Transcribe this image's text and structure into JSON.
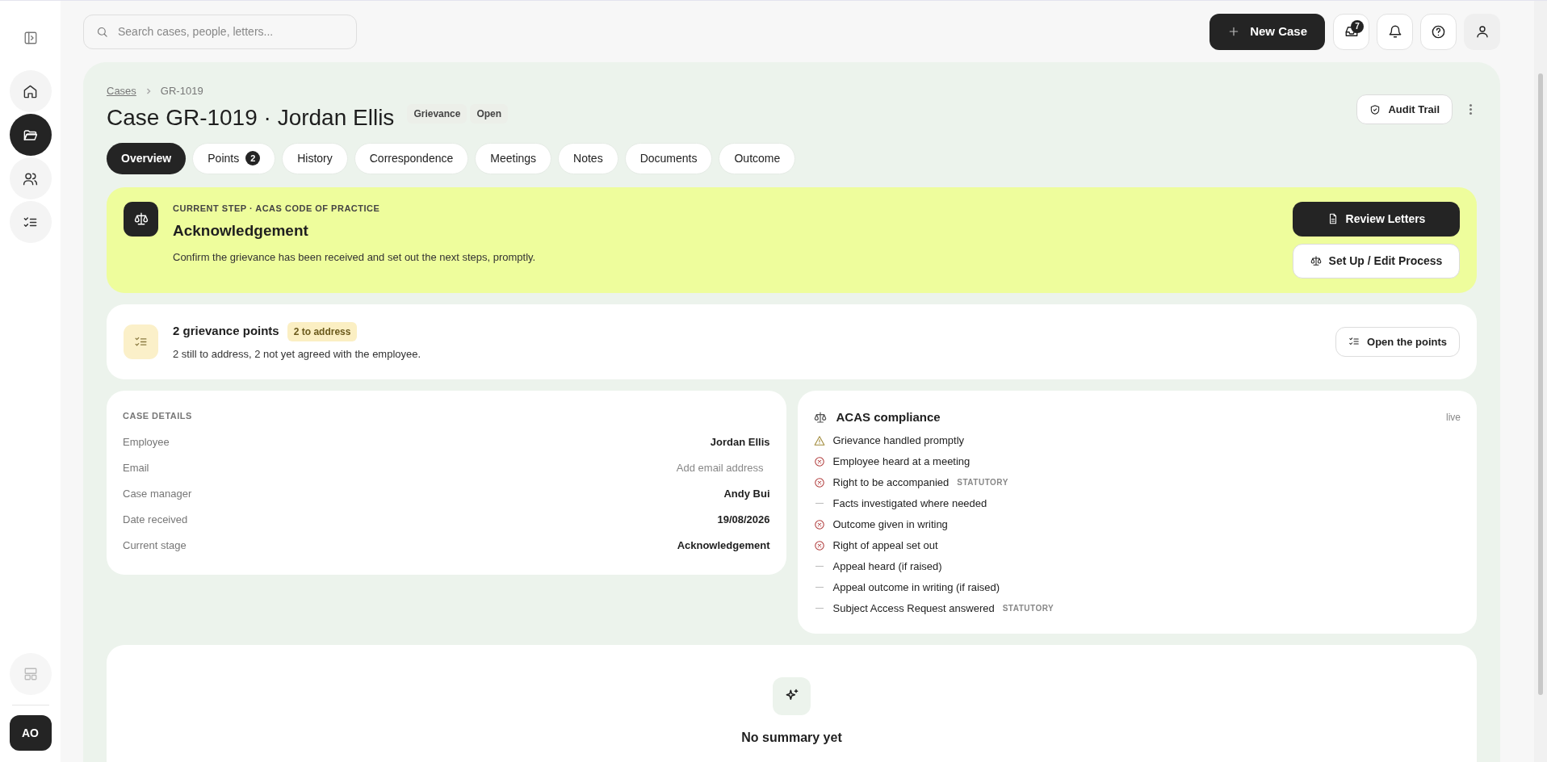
{
  "sidebar": {
    "items": [
      {
        "selected": false
      },
      {
        "selected": true
      },
      {
        "selected": false
      },
      {
        "selected": false
      }
    ],
    "avatar": "AO"
  },
  "search": {
    "placeholder": "Search cases, people, letters..."
  },
  "header": {
    "new_case": "New Case",
    "inbox_count": "7"
  },
  "breadcrumb": [
    "Cases",
    "GR-1019"
  ],
  "title": "Case GR-1019 · Jordan Ellis",
  "badges": [
    "Grievance",
    "Open"
  ],
  "audit_trail": "Audit Trail",
  "tabs": [
    {
      "label": "Overview",
      "selected": true
    },
    {
      "label": "Points",
      "count": "2",
      "selected": false
    },
    {
      "label": "History",
      "selected": false
    },
    {
      "label": "Correspondence",
      "selected": false
    },
    {
      "label": "Meetings",
      "selected": false
    },
    {
      "label": "Notes",
      "selected": false
    },
    {
      "label": "Documents",
      "selected": false
    },
    {
      "label": "Outcome",
      "selected": false
    }
  ],
  "current_step": {
    "eyebrow": "CURRENT STEP · ACAS CODE OF PRACTICE",
    "title": "Acknowledgement",
    "description": "Confirm the grievance has been received and set out the next steps, promptly.",
    "buttons": [
      {
        "kind": "primary",
        "label": "Review Letters"
      },
      {
        "kind": "secondary",
        "label": "Set Up / Edit Process"
      }
    ]
  },
  "points": {
    "title": "2 grievance points",
    "tag": "2 to address",
    "summary": "2 still to address, 2 not yet agreed with the employee.",
    "button": "Open the points"
  },
  "case_details": {
    "heading": "CASE DETAILS",
    "rows": [
      {
        "label": "Employee",
        "value": "Jordan Ellis",
        "kind": "value"
      },
      {
        "label": "Email",
        "value": "Add email address",
        "kind": "placeholder"
      },
      {
        "label": "Case manager",
        "value": "Andy Bui",
        "kind": "value"
      },
      {
        "label": "Date received",
        "value": "19/08/2026",
        "kind": "value"
      },
      {
        "label": "Current stage",
        "value": "Acknowledgement",
        "kind": "value"
      }
    ]
  },
  "compliance": {
    "title": "ACAS compliance",
    "status": "live",
    "items": [
      {
        "label": "Grievance handled promptly",
        "kind": "warning"
      },
      {
        "label": "Employee heard at a meeting",
        "kind": "failed"
      },
      {
        "label": "Right to be accompanied",
        "kind": "failed",
        "tag": "STATUTORY"
      },
      {
        "label": "Facts investigated where needed",
        "kind": "pending"
      },
      {
        "label": "Outcome given in writing",
        "kind": "failed"
      },
      {
        "label": "Right of appeal set out",
        "kind": "failed"
      },
      {
        "label": "Appeal heard (if raised)",
        "kind": "pending"
      },
      {
        "label": "Appeal outcome in writing (if raised)",
        "kind": "pending"
      },
      {
        "label": "Subject Access Request answered",
        "kind": "pending",
        "tag": "STATUTORY"
      }
    ]
  },
  "summary": {
    "title": "No summary yet"
  }
}
